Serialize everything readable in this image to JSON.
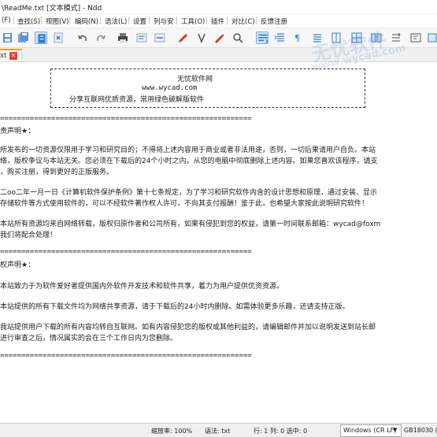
{
  "window": {
    "title": "\\ReadMe.txt [文本模式] - Ndd"
  },
  "menu": [
    "(F)",
    "查找(S)",
    "视图(V)",
    "编码(N)",
    "语法(L)",
    "设置",
    "列与安",
    "工具(O)",
    "插件",
    "对比(C)",
    "反馈注册"
  ],
  "tab": {
    "label": "xt"
  },
  "editor": {
    "banner": {
      "line1": "无忧软件网",
      "line2": "www.wycad.com",
      "line3": "分享互联网优质资源，常用绿色破解版软件"
    },
    "lines": [
      "===========================================================",
      "责声明★：",
      "所发布的一切资源仅限用于学习和研究目的；不得将上述内容用于商业或者非法用途，否则，一切后果请用户自负。本站",
      "络，版权争议与本站无关。您必须在下载后的24个小时之内，从您的电脑中彻底删除上述内容。如果您喜欢该程序，请支",
      "，购买注册，得到更好的正版服务。",
      "二oo二年一月一日《计算机软件保护条例》第十七条规定，为了学习和研究软件内含的设计思想和原理，通过安装、显示",
      "存储软件等方式使用软件的，可以不经软件著作权人许可，不向其支付报酬！鉴于此，也希望大家按此说明研究软件！",
      "本站所有资源均来自网络转载，版权归原作者和公司所有，如果有侵犯到您的权益，请第一时间联系邮箱：wycad@foxm",
      "我们将配合处理！",
      "===========================================================",
      "权声明★：",
      "本站致力于为软件爱好者提供国内外软件开发技术和软件共享，着力为用户提供优资资源。",
      "本站提供的所有下载文件均为网络共享资源，请于下载后的24小时内删除。如需体验更多乐趣，还请支持正版。",
      "我站提供用户下载的所有内容均转自互联网。如有内容侵犯您的版权或其他利益的，请编辑邮件并加以说明发送到站长邮",
      "进行审查之后，情况属实的会在三个工作日内为您删除。",
      "==========================================================="
    ]
  },
  "status": {
    "zoom": "缩放率: 100%",
    "syntax": "语法: txt",
    "position": "行: 1 列: 0 选中: 0",
    "eol": "Windows (CR LF)",
    "encoding": "GB18030 (I"
  },
  "watermark": {
    "text1": "无忧软件",
    "text2": "www.wycad.com"
  }
}
